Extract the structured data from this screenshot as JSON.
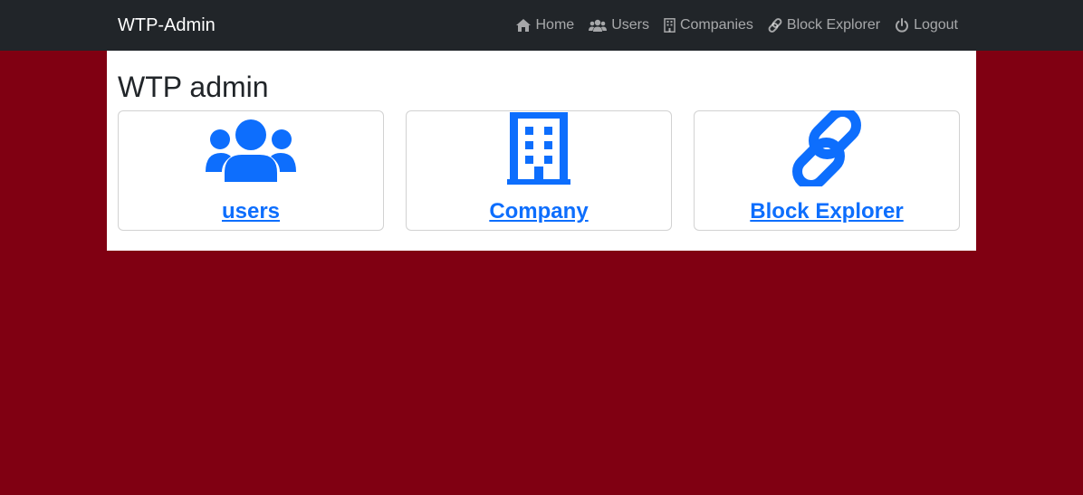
{
  "navbar": {
    "brand": "WTP-Admin",
    "items": [
      {
        "label": "Home",
        "icon": "home-icon"
      },
      {
        "label": "Users",
        "icon": "users-icon"
      },
      {
        "label": "Companies",
        "icon": "building-icon"
      },
      {
        "label": "Block Explorer",
        "icon": "link-icon"
      },
      {
        "label": "Logout",
        "icon": "power-icon"
      }
    ]
  },
  "main": {
    "title": "WTP admin",
    "cards": [
      {
        "label": "users",
        "icon": "users-icon"
      },
      {
        "label": "Company",
        "icon": "building-icon"
      },
      {
        "label": "Block Explorer",
        "icon": "link-icon"
      }
    ]
  },
  "colors": {
    "navbar_bg": "#212529",
    "page_bg": "#800012",
    "accent": "#0d6efd"
  }
}
